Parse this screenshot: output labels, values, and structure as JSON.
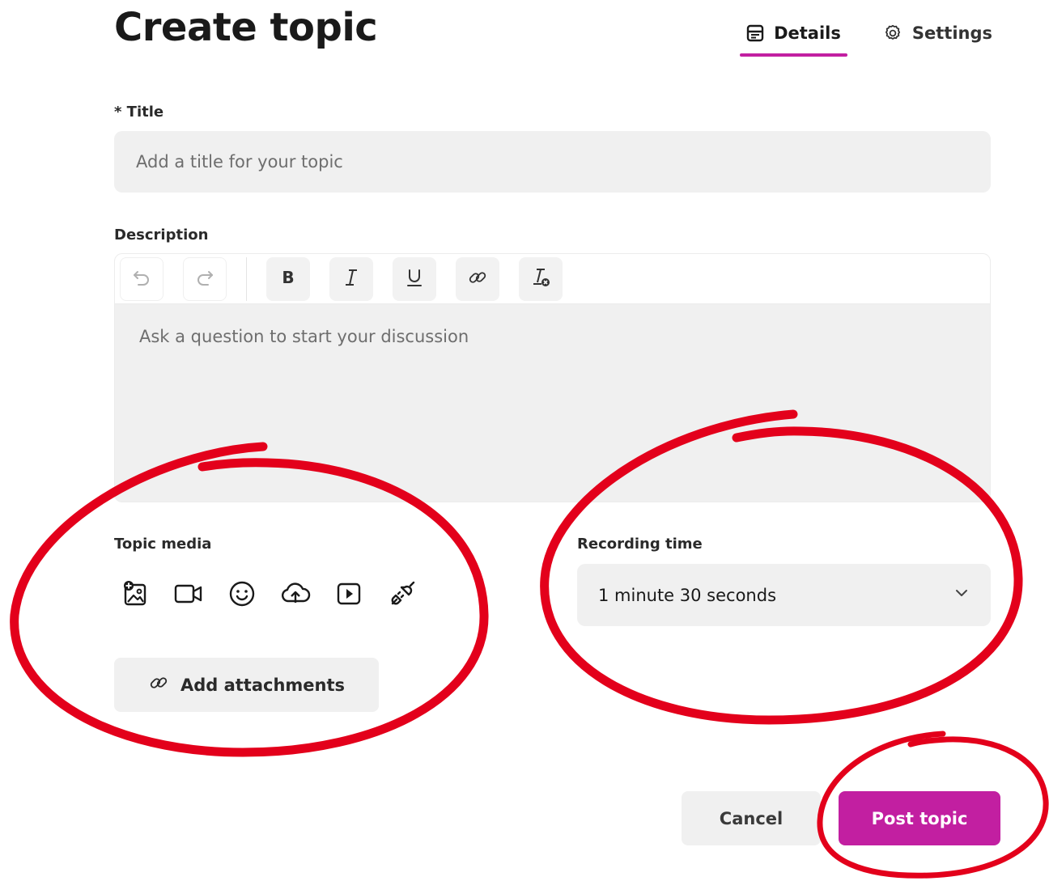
{
  "header": {
    "title": "Create topic"
  },
  "tabs": [
    {
      "label": "Details",
      "icon": "details-icon",
      "active": true
    },
    {
      "label": "Settings",
      "icon": "gear-icon",
      "active": false
    }
  ],
  "title_field": {
    "label": "* Title",
    "placeholder": "Add a title for your topic",
    "value": ""
  },
  "description_field": {
    "label": "Description",
    "placeholder": "Ask a question to start your discussion",
    "toolbar": [
      "undo-icon",
      "redo-icon",
      "bold-icon",
      "italic-icon",
      "underline-icon",
      "link-icon",
      "clear-format-icon"
    ]
  },
  "topic_media": {
    "label": "Topic media",
    "icons": [
      "add-image-icon",
      "video-icon",
      "emoji-icon",
      "cloud-upload-icon",
      "play-icon",
      "plugin-icon"
    ],
    "attach_label": "Add attachments"
  },
  "recording_time": {
    "label": "Recording time",
    "value": "1 minute 30 seconds"
  },
  "actions": {
    "cancel_label": "Cancel",
    "post_label": "Post topic"
  },
  "colors": {
    "accent": "#c21fa1",
    "annotation": "#e3001b",
    "field_bg": "#f0f0f0"
  }
}
